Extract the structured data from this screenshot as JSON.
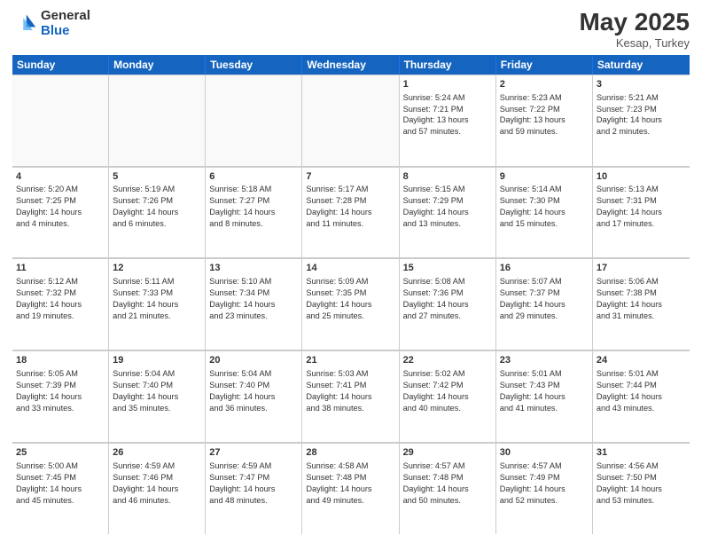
{
  "header": {
    "logo_general": "General",
    "logo_blue": "Blue",
    "month": "May 2025",
    "location": "Kesap, Turkey"
  },
  "days_of_week": [
    "Sunday",
    "Monday",
    "Tuesday",
    "Wednesday",
    "Thursday",
    "Friday",
    "Saturday"
  ],
  "weeks": [
    [
      {
        "day": "",
        "info": ""
      },
      {
        "day": "",
        "info": ""
      },
      {
        "day": "",
        "info": ""
      },
      {
        "day": "",
        "info": ""
      },
      {
        "day": "1",
        "info": "Sunrise: 5:24 AM\nSunset: 7:21 PM\nDaylight: 13 hours\nand 57 minutes."
      },
      {
        "day": "2",
        "info": "Sunrise: 5:23 AM\nSunset: 7:22 PM\nDaylight: 13 hours\nand 59 minutes."
      },
      {
        "day": "3",
        "info": "Sunrise: 5:21 AM\nSunset: 7:23 PM\nDaylight: 14 hours\nand 2 minutes."
      }
    ],
    [
      {
        "day": "4",
        "info": "Sunrise: 5:20 AM\nSunset: 7:25 PM\nDaylight: 14 hours\nand 4 minutes."
      },
      {
        "day": "5",
        "info": "Sunrise: 5:19 AM\nSunset: 7:26 PM\nDaylight: 14 hours\nand 6 minutes."
      },
      {
        "day": "6",
        "info": "Sunrise: 5:18 AM\nSunset: 7:27 PM\nDaylight: 14 hours\nand 8 minutes."
      },
      {
        "day": "7",
        "info": "Sunrise: 5:17 AM\nSunset: 7:28 PM\nDaylight: 14 hours\nand 11 minutes."
      },
      {
        "day": "8",
        "info": "Sunrise: 5:15 AM\nSunset: 7:29 PM\nDaylight: 14 hours\nand 13 minutes."
      },
      {
        "day": "9",
        "info": "Sunrise: 5:14 AM\nSunset: 7:30 PM\nDaylight: 14 hours\nand 15 minutes."
      },
      {
        "day": "10",
        "info": "Sunrise: 5:13 AM\nSunset: 7:31 PM\nDaylight: 14 hours\nand 17 minutes."
      }
    ],
    [
      {
        "day": "11",
        "info": "Sunrise: 5:12 AM\nSunset: 7:32 PM\nDaylight: 14 hours\nand 19 minutes."
      },
      {
        "day": "12",
        "info": "Sunrise: 5:11 AM\nSunset: 7:33 PM\nDaylight: 14 hours\nand 21 minutes."
      },
      {
        "day": "13",
        "info": "Sunrise: 5:10 AM\nSunset: 7:34 PM\nDaylight: 14 hours\nand 23 minutes."
      },
      {
        "day": "14",
        "info": "Sunrise: 5:09 AM\nSunset: 7:35 PM\nDaylight: 14 hours\nand 25 minutes."
      },
      {
        "day": "15",
        "info": "Sunrise: 5:08 AM\nSunset: 7:36 PM\nDaylight: 14 hours\nand 27 minutes."
      },
      {
        "day": "16",
        "info": "Sunrise: 5:07 AM\nSunset: 7:37 PM\nDaylight: 14 hours\nand 29 minutes."
      },
      {
        "day": "17",
        "info": "Sunrise: 5:06 AM\nSunset: 7:38 PM\nDaylight: 14 hours\nand 31 minutes."
      }
    ],
    [
      {
        "day": "18",
        "info": "Sunrise: 5:05 AM\nSunset: 7:39 PM\nDaylight: 14 hours\nand 33 minutes."
      },
      {
        "day": "19",
        "info": "Sunrise: 5:04 AM\nSunset: 7:40 PM\nDaylight: 14 hours\nand 35 minutes."
      },
      {
        "day": "20",
        "info": "Sunrise: 5:04 AM\nSunset: 7:40 PM\nDaylight: 14 hours\nand 36 minutes."
      },
      {
        "day": "21",
        "info": "Sunrise: 5:03 AM\nSunset: 7:41 PM\nDaylight: 14 hours\nand 38 minutes."
      },
      {
        "day": "22",
        "info": "Sunrise: 5:02 AM\nSunset: 7:42 PM\nDaylight: 14 hours\nand 40 minutes."
      },
      {
        "day": "23",
        "info": "Sunrise: 5:01 AM\nSunset: 7:43 PM\nDaylight: 14 hours\nand 41 minutes."
      },
      {
        "day": "24",
        "info": "Sunrise: 5:01 AM\nSunset: 7:44 PM\nDaylight: 14 hours\nand 43 minutes."
      }
    ],
    [
      {
        "day": "25",
        "info": "Sunrise: 5:00 AM\nSunset: 7:45 PM\nDaylight: 14 hours\nand 45 minutes."
      },
      {
        "day": "26",
        "info": "Sunrise: 4:59 AM\nSunset: 7:46 PM\nDaylight: 14 hours\nand 46 minutes."
      },
      {
        "day": "27",
        "info": "Sunrise: 4:59 AM\nSunset: 7:47 PM\nDaylight: 14 hours\nand 48 minutes."
      },
      {
        "day": "28",
        "info": "Sunrise: 4:58 AM\nSunset: 7:48 PM\nDaylight: 14 hours\nand 49 minutes."
      },
      {
        "day": "29",
        "info": "Sunrise: 4:57 AM\nSunset: 7:48 PM\nDaylight: 14 hours\nand 50 minutes."
      },
      {
        "day": "30",
        "info": "Sunrise: 4:57 AM\nSunset: 7:49 PM\nDaylight: 14 hours\nand 52 minutes."
      },
      {
        "day": "31",
        "info": "Sunrise: 4:56 AM\nSunset: 7:50 PM\nDaylight: 14 hours\nand 53 minutes."
      }
    ]
  ]
}
